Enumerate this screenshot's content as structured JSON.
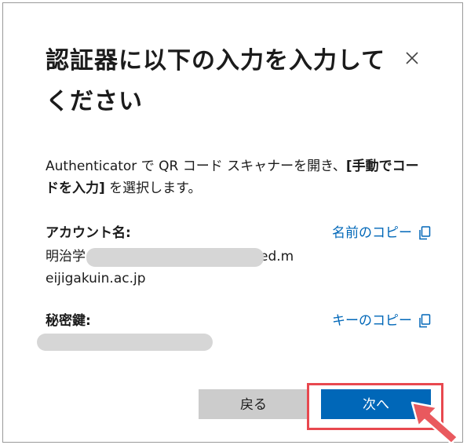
{
  "dialog": {
    "title": "認証器に以下の入力を入力してください",
    "description_prefix": "Authenticator で QR コード スキャナーを開き、",
    "description_emphasis": "[手動でコードを入力]",
    "description_suffix": " を選択します。"
  },
  "account": {
    "label": "アカウント名:",
    "value_prefix": "明治学",
    "value_suffix": "ed.m",
    "value_line2": "eijigakuin.ac.jp",
    "copy_label": "名前のコピー"
  },
  "secret": {
    "label": "秘密鍵:",
    "copy_label": "キーのコピー"
  },
  "buttons": {
    "back": "戻る",
    "next": "次へ"
  },
  "icons": {
    "close": "close-icon",
    "copy": "copy-icon",
    "pointer": "pointer-arrow-icon"
  },
  "colors": {
    "link": "#0067b8",
    "primary_button": "#0067b8",
    "secondary_button": "#cccccc",
    "highlight": "#e8484f",
    "redaction": "#d6d6d6"
  }
}
